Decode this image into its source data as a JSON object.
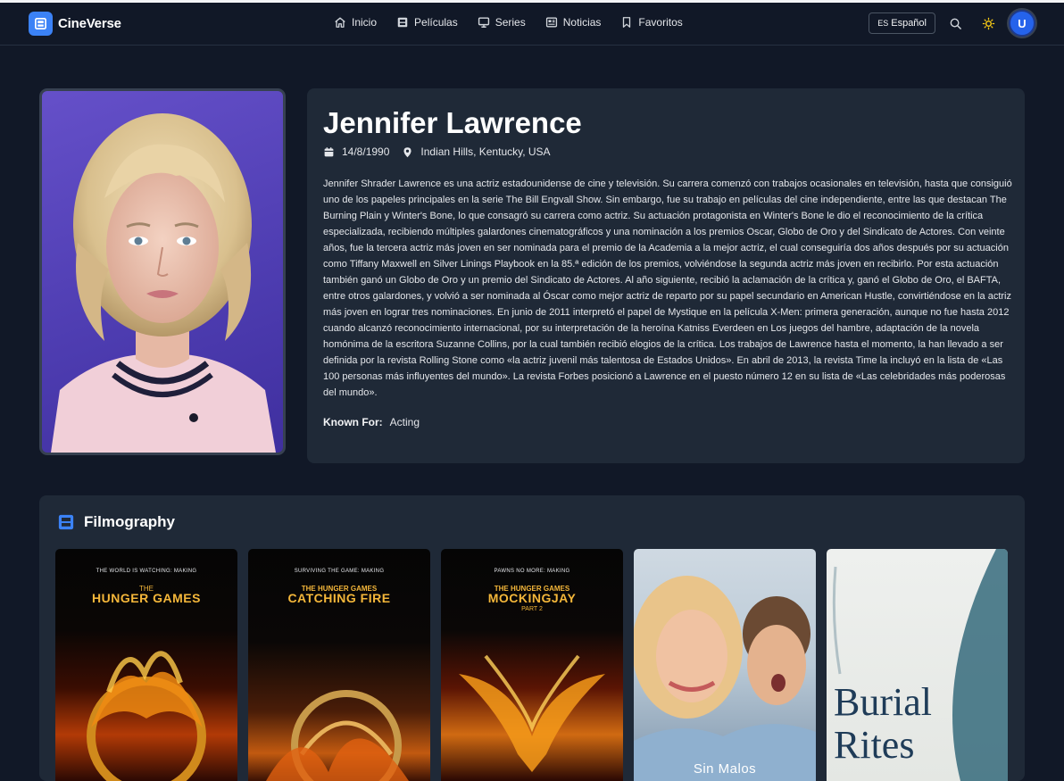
{
  "brand": {
    "name": "CineVerse",
    "accent": "#3b82f6"
  },
  "nav": {
    "items": [
      {
        "label": "Inicio",
        "icon": "home-icon"
      },
      {
        "label": "Películas",
        "icon": "film-icon"
      },
      {
        "label": "Series",
        "icon": "tv-icon"
      },
      {
        "label": "Noticias",
        "icon": "newspaper-icon"
      },
      {
        "label": "Favoritos",
        "icon": "bookmark-icon"
      }
    ],
    "language": {
      "flag": "ES",
      "label": "Español"
    },
    "avatar_initial": "U"
  },
  "person": {
    "name": "Jennifer Lawrence",
    "birthday": "14/8/1990",
    "birthplace": "Indian Hills, Kentucky, USA",
    "biography": "Jennifer Shrader Lawrence es una actriz estadounidense de cine y televisión. Su carrera comenzó con trabajos ocasionales en televisión, hasta que consiguió uno de los papeles principales en la serie The Bill Engvall Show. Sin embargo, fue su trabajo en películas del cine independiente, entre las que destacan The Burning Plain y Winter's Bone, lo que consagró su carrera como actriz. Su actuación protagonista en Winter's Bone le dio el reconocimiento de la crítica especializada, recibiendo múltiples galardones cinematográficos y una nominación a los premios Oscar, Globo de Oro y del Sindicato de Actores. Con veinte años, fue la tercera actriz más joven en ser nominada para el premio de la Academia a la mejor actriz, el cual conseguiría dos años después por su actuación como Tiffany Maxwell en Silver Linings Playbook en la 85.ª edición de los premios, volviéndose la segunda actriz más joven en recibirlo. Por esta actuación también ganó un Globo de Oro y un premio del Sindicato de Actores. Al año siguiente, recibió la aclamación de la crítica y, ganó el Globo de Oro, el BAFTA, entre otros galardones, y volvió a ser nominada al Óscar como mejor actriz de reparto por su papel secundario en American Hustle, convirtiéndose en la actriz más joven en lograr tres nominaciones. En junio de 2011 interpretó el papel de Mystique en la película X-Men: primera generación, aunque no fue hasta 2012 cuando alcanzó reconocimiento internacional, por su interpretación de la heroína Katniss Everdeen en Los juegos del hambre, adaptación de la novela homónima de la escritora Suzanne Collins, por la cual también recibió elogios de la crítica. Los trabajos de Lawrence hasta el momento, la han llevado a ser definida por la revista Rolling Stone como «la actriz juvenil más talentosa de Estados Unidos». En abril de 2013, la revista Time la incluyó en la lista de «Las 100 personas más influyentes del mundo». La revista Forbes posicionó a Lawrence en el puesto número 12 en su lista de «Las celebridades más poderosas del mundo».",
    "known_for_label": "Known For:",
    "known_for": "Acting"
  },
  "filmography": {
    "title": "Filmography",
    "posters": [
      {
        "tagline": "THE WORLD IS WATCHING: MAKING",
        "title_top": "THE",
        "title": "HUNGER GAMES",
        "subtitle": ""
      },
      {
        "tagline": "SURVIVING THE GAME: MAKING",
        "title_top": "THE HUNGER GAMES",
        "title": "CATCHING FIRE",
        "subtitle": ""
      },
      {
        "tagline": "PAWNS NO MORE: MAKING",
        "title_top": "THE HUNGER GAMES",
        "title": "MOCKINGJAY",
        "subtitle": "PART 2"
      },
      {
        "tagline": "",
        "title_top": "",
        "title": "Sin Malos",
        "subtitle": ""
      },
      {
        "tagline": "",
        "title_top": "",
        "title": "Burial Rites",
        "subtitle": ""
      }
    ]
  }
}
